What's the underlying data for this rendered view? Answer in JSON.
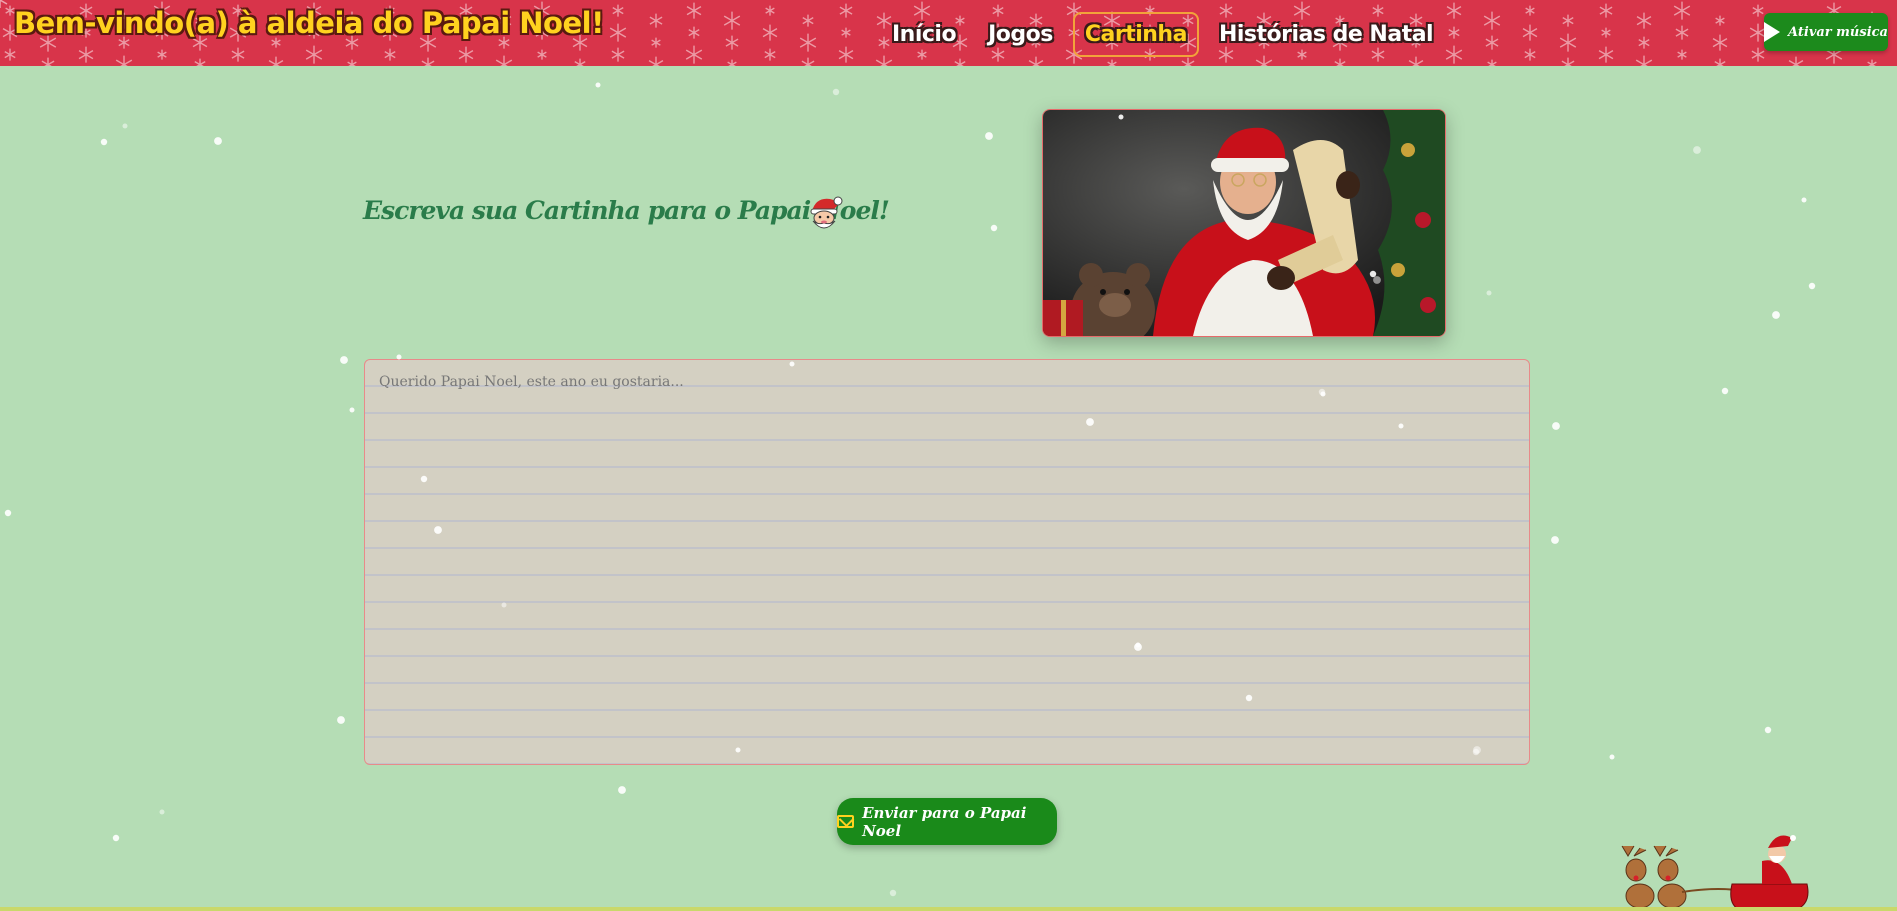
{
  "header": {
    "title": "Bem-vindo(a) à aldeia do Papai Noel!",
    "nav": [
      {
        "label": "Início",
        "active": false
      },
      {
        "label": "Jogos",
        "active": false
      },
      {
        "label": "Cartinha",
        "active": true
      },
      {
        "label": "Histórias de Natal",
        "active": false
      }
    ],
    "music_button": {
      "label": "Ativar música",
      "icon": "play-icon"
    }
  },
  "main": {
    "heading": "Escreva sua Cartinha para o Papai Noel!",
    "heading_icon": "santa-face-icon",
    "letter": {
      "placeholder": "Querido Papai Noel, este ano eu gostaria...",
      "value": ""
    },
    "send_button": {
      "label": "Enviar para o Papai Noel",
      "icon": "mail-icon"
    }
  },
  "colors": {
    "background": "#b5ddb5",
    "header": "#d8344a",
    "title": "#ffd21f",
    "accent_green": "#1a8a1a",
    "heading": "#2a7c4a"
  }
}
